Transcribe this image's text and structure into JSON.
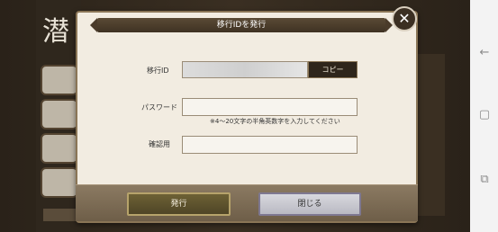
{
  "dialog": {
    "title": "移行IDを発行",
    "fields": {
      "id_label": "移行ID",
      "password_label": "パスワード",
      "confirm_label": "確認用",
      "copy_label": "コピー",
      "password_note": "※4～20文字の半角英数字を入力してください"
    },
    "buttons": {
      "issue": "発行",
      "close": "閉じる"
    }
  },
  "background": {
    "big_char": "潜"
  }
}
